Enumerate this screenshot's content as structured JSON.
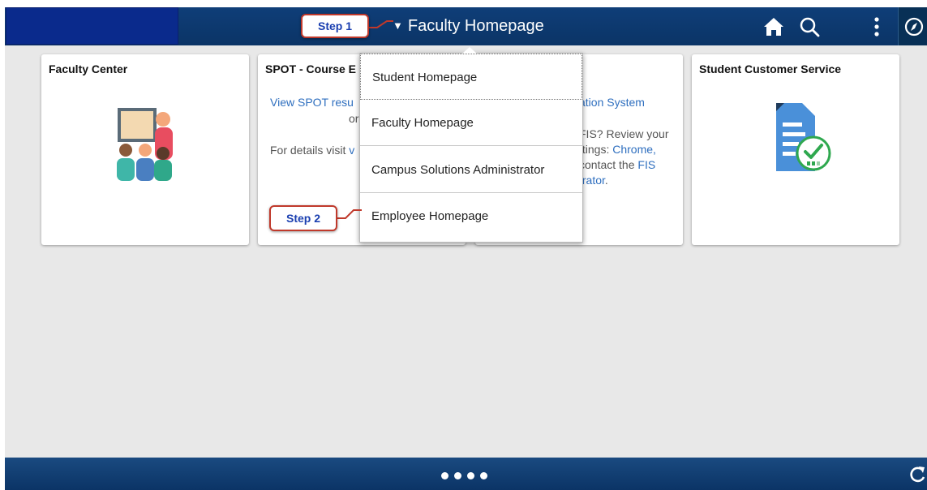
{
  "header": {
    "title": "Faculty Homepage",
    "caret": "▼",
    "icons": [
      "home-icon",
      "search-icon",
      "more-vertical-icon",
      "navbar-compass-icon"
    ]
  },
  "tiles": [
    {
      "title": "Faculty Center",
      "icon": "classroom-teacher-icon"
    },
    {
      "title": "SPOT - Course E",
      "link_line1": "View SPOT resu",
      "line2": "or",
      "line3_prefix": "For details visit",
      "line3_link": "v"
    },
    {
      "line1": "ation System",
      "line2": "FIS? Review your",
      "line3_a": "ttings: ",
      "line3_link": "Chrome,",
      "line4_a": "contact the ",
      "line4_link": "FIS",
      "line5_link": "trator",
      "line5_end": "."
    },
    {
      "title": "Student Customer Service",
      "icon": "document-checkmark-icon"
    }
  ],
  "dropdown": {
    "items": [
      "Student Homepage",
      "Faculty Homepage",
      "Campus Solutions Administrator",
      "Employee Homepage"
    ]
  },
  "callouts": {
    "step1": "Step 1",
    "step2": "Step 2"
  },
  "footer": {
    "page_dots": 4,
    "icons": [
      "refresh-icon"
    ]
  },
  "colors": {
    "header_bg": "#0b3466",
    "callout_border": "#c0392b",
    "callout_text": "#1a3fb0",
    "link": "#2f6fbf"
  }
}
